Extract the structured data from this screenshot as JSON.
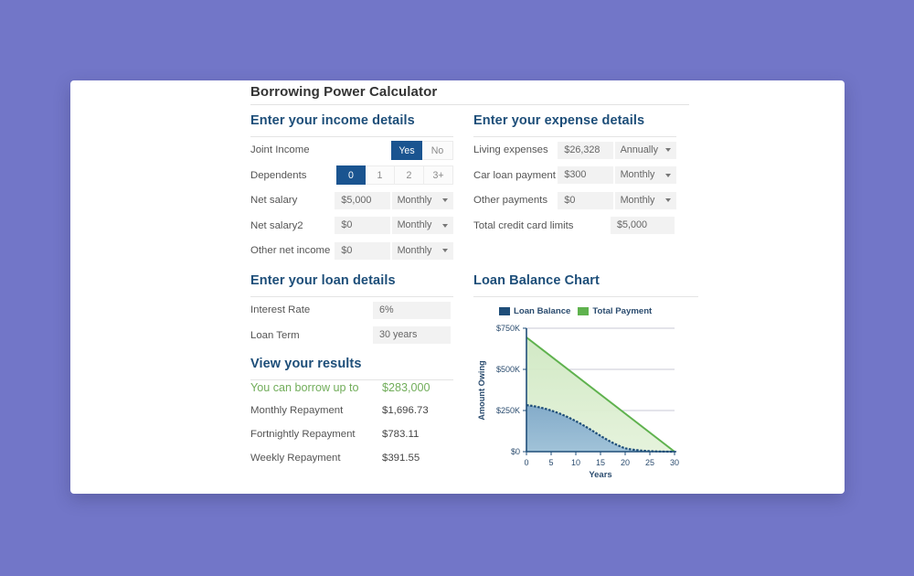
{
  "theme": {
    "page_background": "#7276c8",
    "card_background": "#ffffff",
    "heading_color": "#1d4e79",
    "accent_blue": "#1a5490",
    "accent_green": "#71ad5a",
    "chart_balance_color": "#1f4e79",
    "chart_payment_color": "#5fb24e"
  },
  "app": {
    "title": "Borrowing Power Calculator"
  },
  "income": {
    "heading": "Enter your income details",
    "joint_income": {
      "label": "Joint Income",
      "options": [
        "Yes",
        "No"
      ],
      "selected": "Yes"
    },
    "dependents": {
      "label": "Dependents",
      "options": [
        "0",
        "1",
        "2",
        "3+"
      ],
      "selected": "0"
    },
    "fields": [
      {
        "label": "Net salary",
        "value": "$5,000",
        "frequency": "Monthly"
      },
      {
        "label": "Net salary2",
        "value": "$0",
        "frequency": "Monthly"
      },
      {
        "label": "Other net income",
        "value": "$0",
        "frequency": "Monthly"
      }
    ]
  },
  "expenses": {
    "heading": "Enter your expense details",
    "fields": [
      {
        "label": "Living expenses",
        "value": "$26,328",
        "frequency": "Annually"
      },
      {
        "label": "Car loan payment",
        "value": "$300",
        "frequency": "Monthly"
      },
      {
        "label": "Other payments",
        "value": "$0",
        "frequency": "Monthly"
      }
    ],
    "credit_limits": {
      "label": "Total credit card limits",
      "value": "$5,000"
    }
  },
  "loan": {
    "heading": "Enter your loan details",
    "fields": [
      {
        "label": "Interest Rate",
        "value": "6%"
      },
      {
        "label": "Loan Term",
        "value": "30 years"
      }
    ]
  },
  "results": {
    "heading": "View your results",
    "rows": [
      {
        "label": "You can borrow up to",
        "value": "$283,000",
        "highlight": true
      },
      {
        "label": "Monthly Repayment",
        "value": "$1,696.73",
        "highlight": false
      },
      {
        "label": "Fortnightly Repayment",
        "value": "$783.11",
        "highlight": false
      },
      {
        "label": "Weekly Repayment",
        "value": "$391.55",
        "highlight": false
      }
    ]
  },
  "chart_panel": {
    "heading": "Loan Balance Chart"
  },
  "chart_data": {
    "type": "area",
    "title": "Loan Balance Chart",
    "xlabel": "Years",
    "ylabel": "Amount Owing",
    "xlim": [
      0,
      30
    ],
    "ylim": [
      0,
      750000
    ],
    "xticks": [
      0,
      5,
      10,
      15,
      20,
      25,
      30
    ],
    "xtick_labels": [
      "0",
      "5",
      "10",
      "15",
      "20",
      "25",
      "30"
    ],
    "yticks": [
      0,
      250000,
      500000,
      750000
    ],
    "ytick_labels": [
      "$0",
      "$250K",
      "$500K",
      "$750K"
    ],
    "grid": true,
    "legend_position": "top",
    "x": [
      0,
      2,
      4,
      6,
      8,
      10,
      12,
      14,
      16,
      18,
      20,
      22,
      24,
      26,
      28,
      30
    ],
    "series": [
      {
        "name": "Loan Balance",
        "color": "#1f4e79",
        "values": [
          283000,
          276800,
          269000,
          259600,
          248300,
          235000,
          219400,
          201200,
          180000,
          155600,
          127400,
          95000,
          58000,
          29000,
          11000,
          0
        ]
      },
      {
        "name": "Total Payment",
        "color": "#5fb24e",
        "values": [
          610000,
          569300,
          528700,
          488000,
          447300,
          406700,
          366000,
          325300,
          284700,
          244000,
          203300,
          162700,
          122000,
          81300,
          40700,
          0
        ]
      }
    ]
  }
}
